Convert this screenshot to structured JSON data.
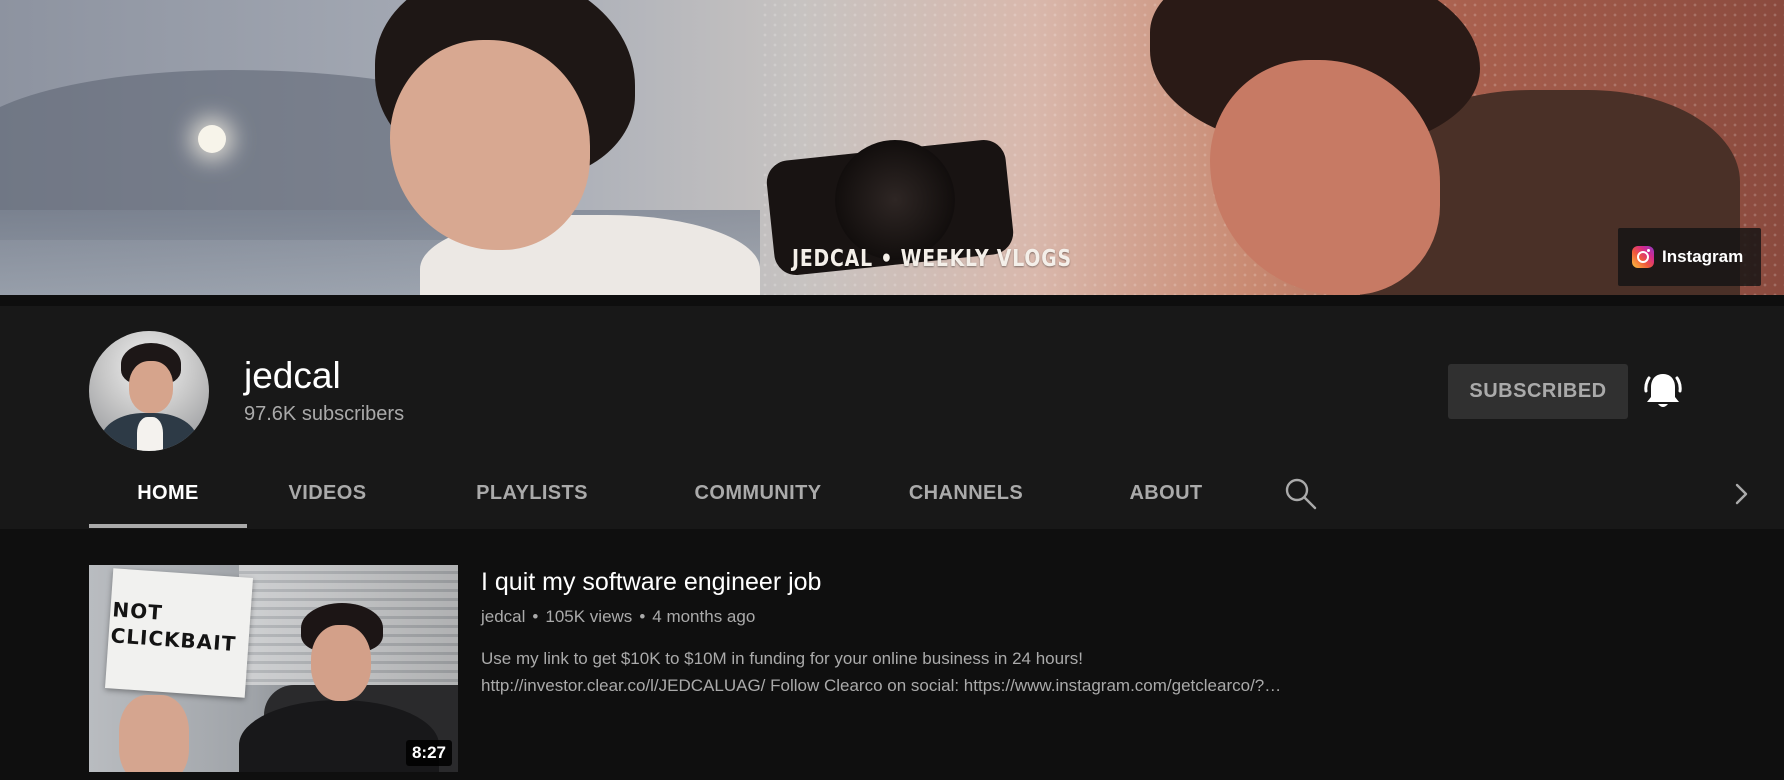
{
  "banner": {
    "caption": "JEDCAL • WEEKLY VLOGS",
    "link": {
      "label": "Instagram",
      "icon": "instagram-icon"
    }
  },
  "channel": {
    "name": "jedcal",
    "subscribers": "97.6K subscribers",
    "subscribe_label": "SUBSCRIBED",
    "bell_icon": "notification-bell-icon"
  },
  "tabs": [
    {
      "label": "HOME",
      "active": true
    },
    {
      "label": "VIDEOS"
    },
    {
      "label": "PLAYLISTS"
    },
    {
      "label": "COMMUNITY"
    },
    {
      "label": "CHANNELS"
    },
    {
      "label": "ABOUT"
    }
  ],
  "tab_icons": {
    "search": "search-icon",
    "next": "chevron-right-icon"
  },
  "featured_video": {
    "thumbnail_text_line1": "NOT",
    "thumbnail_text_line2": "CLICKBAIT",
    "duration": "8:27",
    "title": "I quit my software engineer job",
    "channel": "jedcal",
    "views": "105K views",
    "age": "4 months ago",
    "description_line1": "Use my link to get $10K to $10M in funding for your online business in 24 hours!",
    "description_line2": "http://investor.clear.co/l/JEDCALUAG/ Follow Clearco on social: https://www.instagram.com/getclearco/?…"
  },
  "colors": {
    "page_bg": "#0f0f0f",
    "header_bg": "#181818",
    "secondary_text": "#aaaaaa",
    "button_bg": "#303030"
  }
}
